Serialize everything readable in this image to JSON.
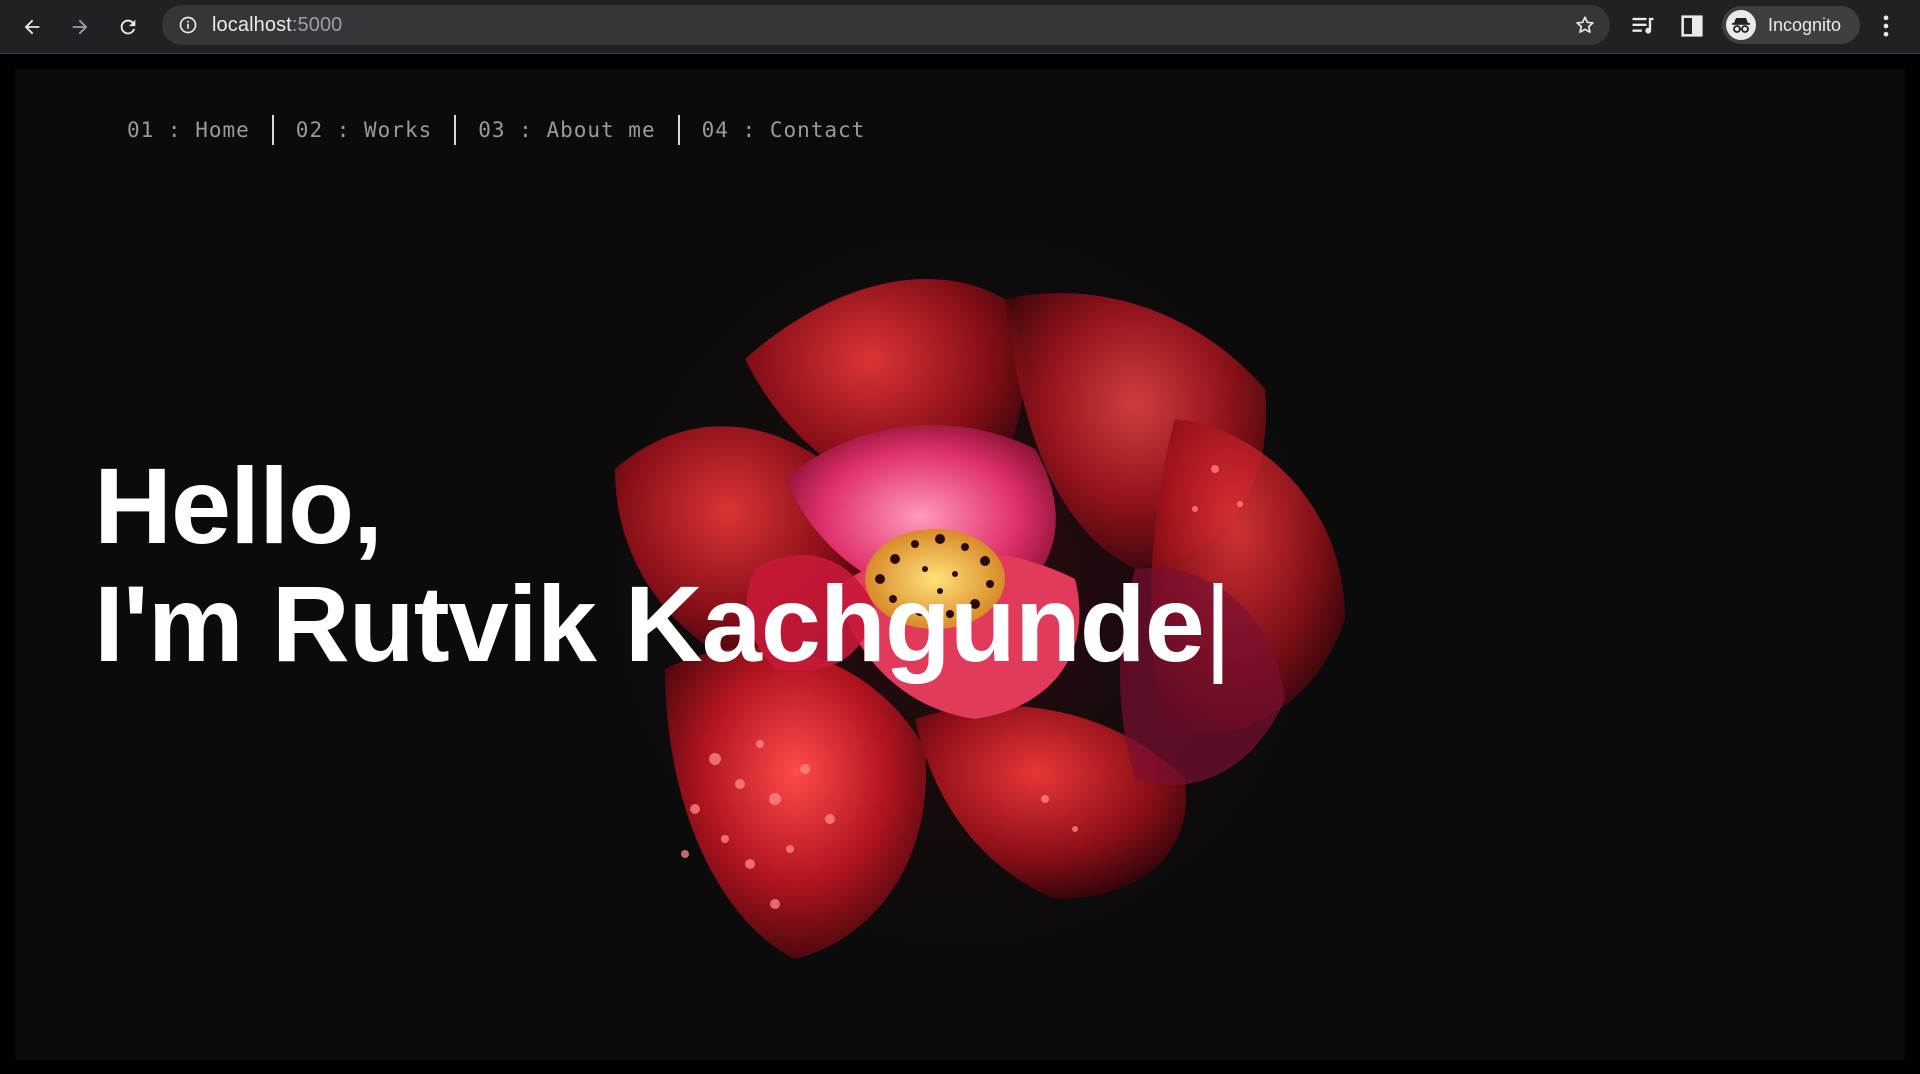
{
  "browser": {
    "url_host": "localhost",
    "url_port": ":5000",
    "profile_label": "Incognito"
  },
  "site": {
    "nav": [
      {
        "label": "01 : Home"
      },
      {
        "label": "02 : Works"
      },
      {
        "label": "03 : About me"
      },
      {
        "label": "04 : Contact"
      }
    ],
    "hero": {
      "greeting": "Hello,",
      "name_line": "I'm Rutvik Kachgunde",
      "cursor": "|"
    }
  },
  "colors": {
    "page_background": "#0b0b0c",
    "flower_red": "#d8202c",
    "flower_pink": "#ff4f8a",
    "text": "#ffffff",
    "nav_text": "#9a9a9a"
  }
}
